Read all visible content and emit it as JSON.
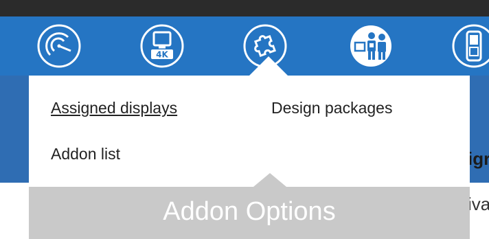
{
  "nav": {
    "icons": [
      {
        "name": "radar-icon"
      },
      {
        "name": "display-4k-icon"
      },
      {
        "name": "puzzle-addon-icon"
      },
      {
        "name": "kiosk-users-icon"
      },
      {
        "name": "mobile-phone-icon"
      }
    ],
    "active_icon": "puzzle-addon-icon"
  },
  "dropdown": {
    "items": [
      {
        "label": "Assigned displays",
        "underlined": true
      },
      {
        "label": "Design packages",
        "underlined": false
      },
      {
        "label": "Addon list",
        "underlined": false
      }
    ],
    "footer_label": "Addon Options"
  },
  "background": {
    "header_text": "igr",
    "row_text": "iva"
  },
  "colors": {
    "nav_bar": "#2575c3",
    "secondary_bar": "#2f6db3",
    "top_strip": "#2b2b2b",
    "footer_box": "#c9c9c9",
    "menu_text": "#222222"
  }
}
